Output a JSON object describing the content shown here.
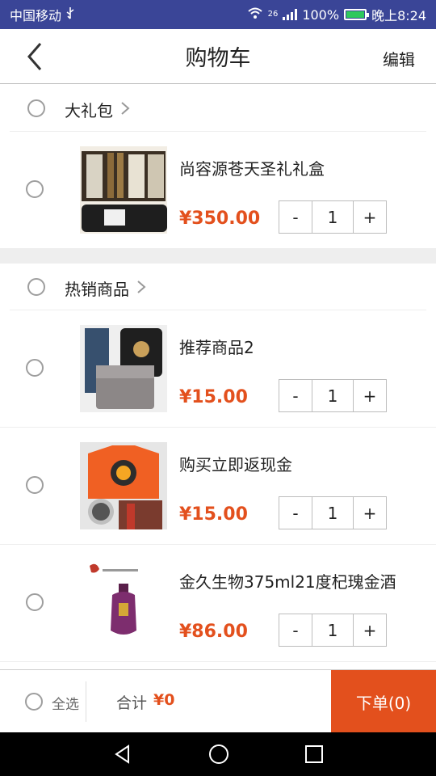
{
  "status": {
    "carrier": "中国移动",
    "network": "26",
    "battery": "100%",
    "time": "晚上8:24"
  },
  "header": {
    "title": "购物车",
    "edit_label": "编辑"
  },
  "shops": [
    {
      "name": "大礼包",
      "items": [
        {
          "name": "尚容源苍天圣礼礼盒",
          "price": "¥350.00",
          "qty": "1"
        }
      ]
    },
    {
      "name": "热销商品",
      "items": [
        {
          "name": "推荐商品2",
          "price": "¥15.00",
          "qty": "1"
        },
        {
          "name": "购买立即返现金",
          "price": "¥15.00",
          "qty": "1"
        },
        {
          "name": "金久生物375ml21度杞瑰金酒",
          "price": "¥86.00",
          "qty": "1"
        }
      ]
    }
  ],
  "stepper": {
    "minus": "-",
    "plus": "+"
  },
  "footer": {
    "select_all": "全选",
    "total_label": "合计",
    "total_value": "¥0",
    "order_button": "下单(0)"
  },
  "colors": {
    "accent": "#e3501d",
    "status_bar": "#3a4597"
  }
}
